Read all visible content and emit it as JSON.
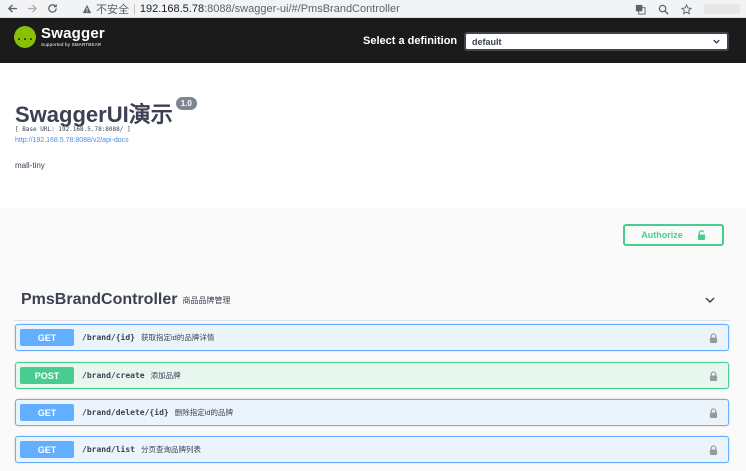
{
  "browser": {
    "insecure_label": "不安全",
    "separator": "|",
    "url_host": "192.168.5.78",
    "url_path": ":8088/swagger-ui/#/PmsBrandController",
    "icons": [
      "back-arrow",
      "forward-arrow",
      "reload",
      "warning",
      "translate",
      "zoom",
      "star"
    ]
  },
  "topbar": {
    "logo_name": "Swagger",
    "logo_sub": "Supported by SMARTBEAR",
    "logo_glyph": "{...}",
    "select_label": "Select a definition",
    "select_value": "default"
  },
  "info": {
    "title": "SwaggerUI演示",
    "version": "1.0",
    "base_url": "[ Base URL: 192.168.5.78:8088/ ]",
    "docs_link": "http://192.168.5.78:8088/v2/api-docs",
    "description": "mall-tiny"
  },
  "auth": {
    "authorize_label": "Authorize"
  },
  "tag": {
    "name": "PmsBrandController",
    "description": "商品品牌管理"
  },
  "operations": [
    {
      "method": "GET",
      "path": "/brand/{id}",
      "summary": "获取指定id的品牌详情"
    },
    {
      "method": "POST",
      "path": "/brand/create",
      "summary": "添加品牌"
    },
    {
      "method": "GET",
      "path": "/brand/delete/{id}",
      "summary": "删除指定id的品牌"
    },
    {
      "method": "GET",
      "path": "/brand/list",
      "summary": "分页查询品牌列表"
    }
  ],
  "colors": {
    "get": "#61affe",
    "post": "#49cc90",
    "topbar": "#1b1b1b",
    "logo": "#89bf04"
  }
}
